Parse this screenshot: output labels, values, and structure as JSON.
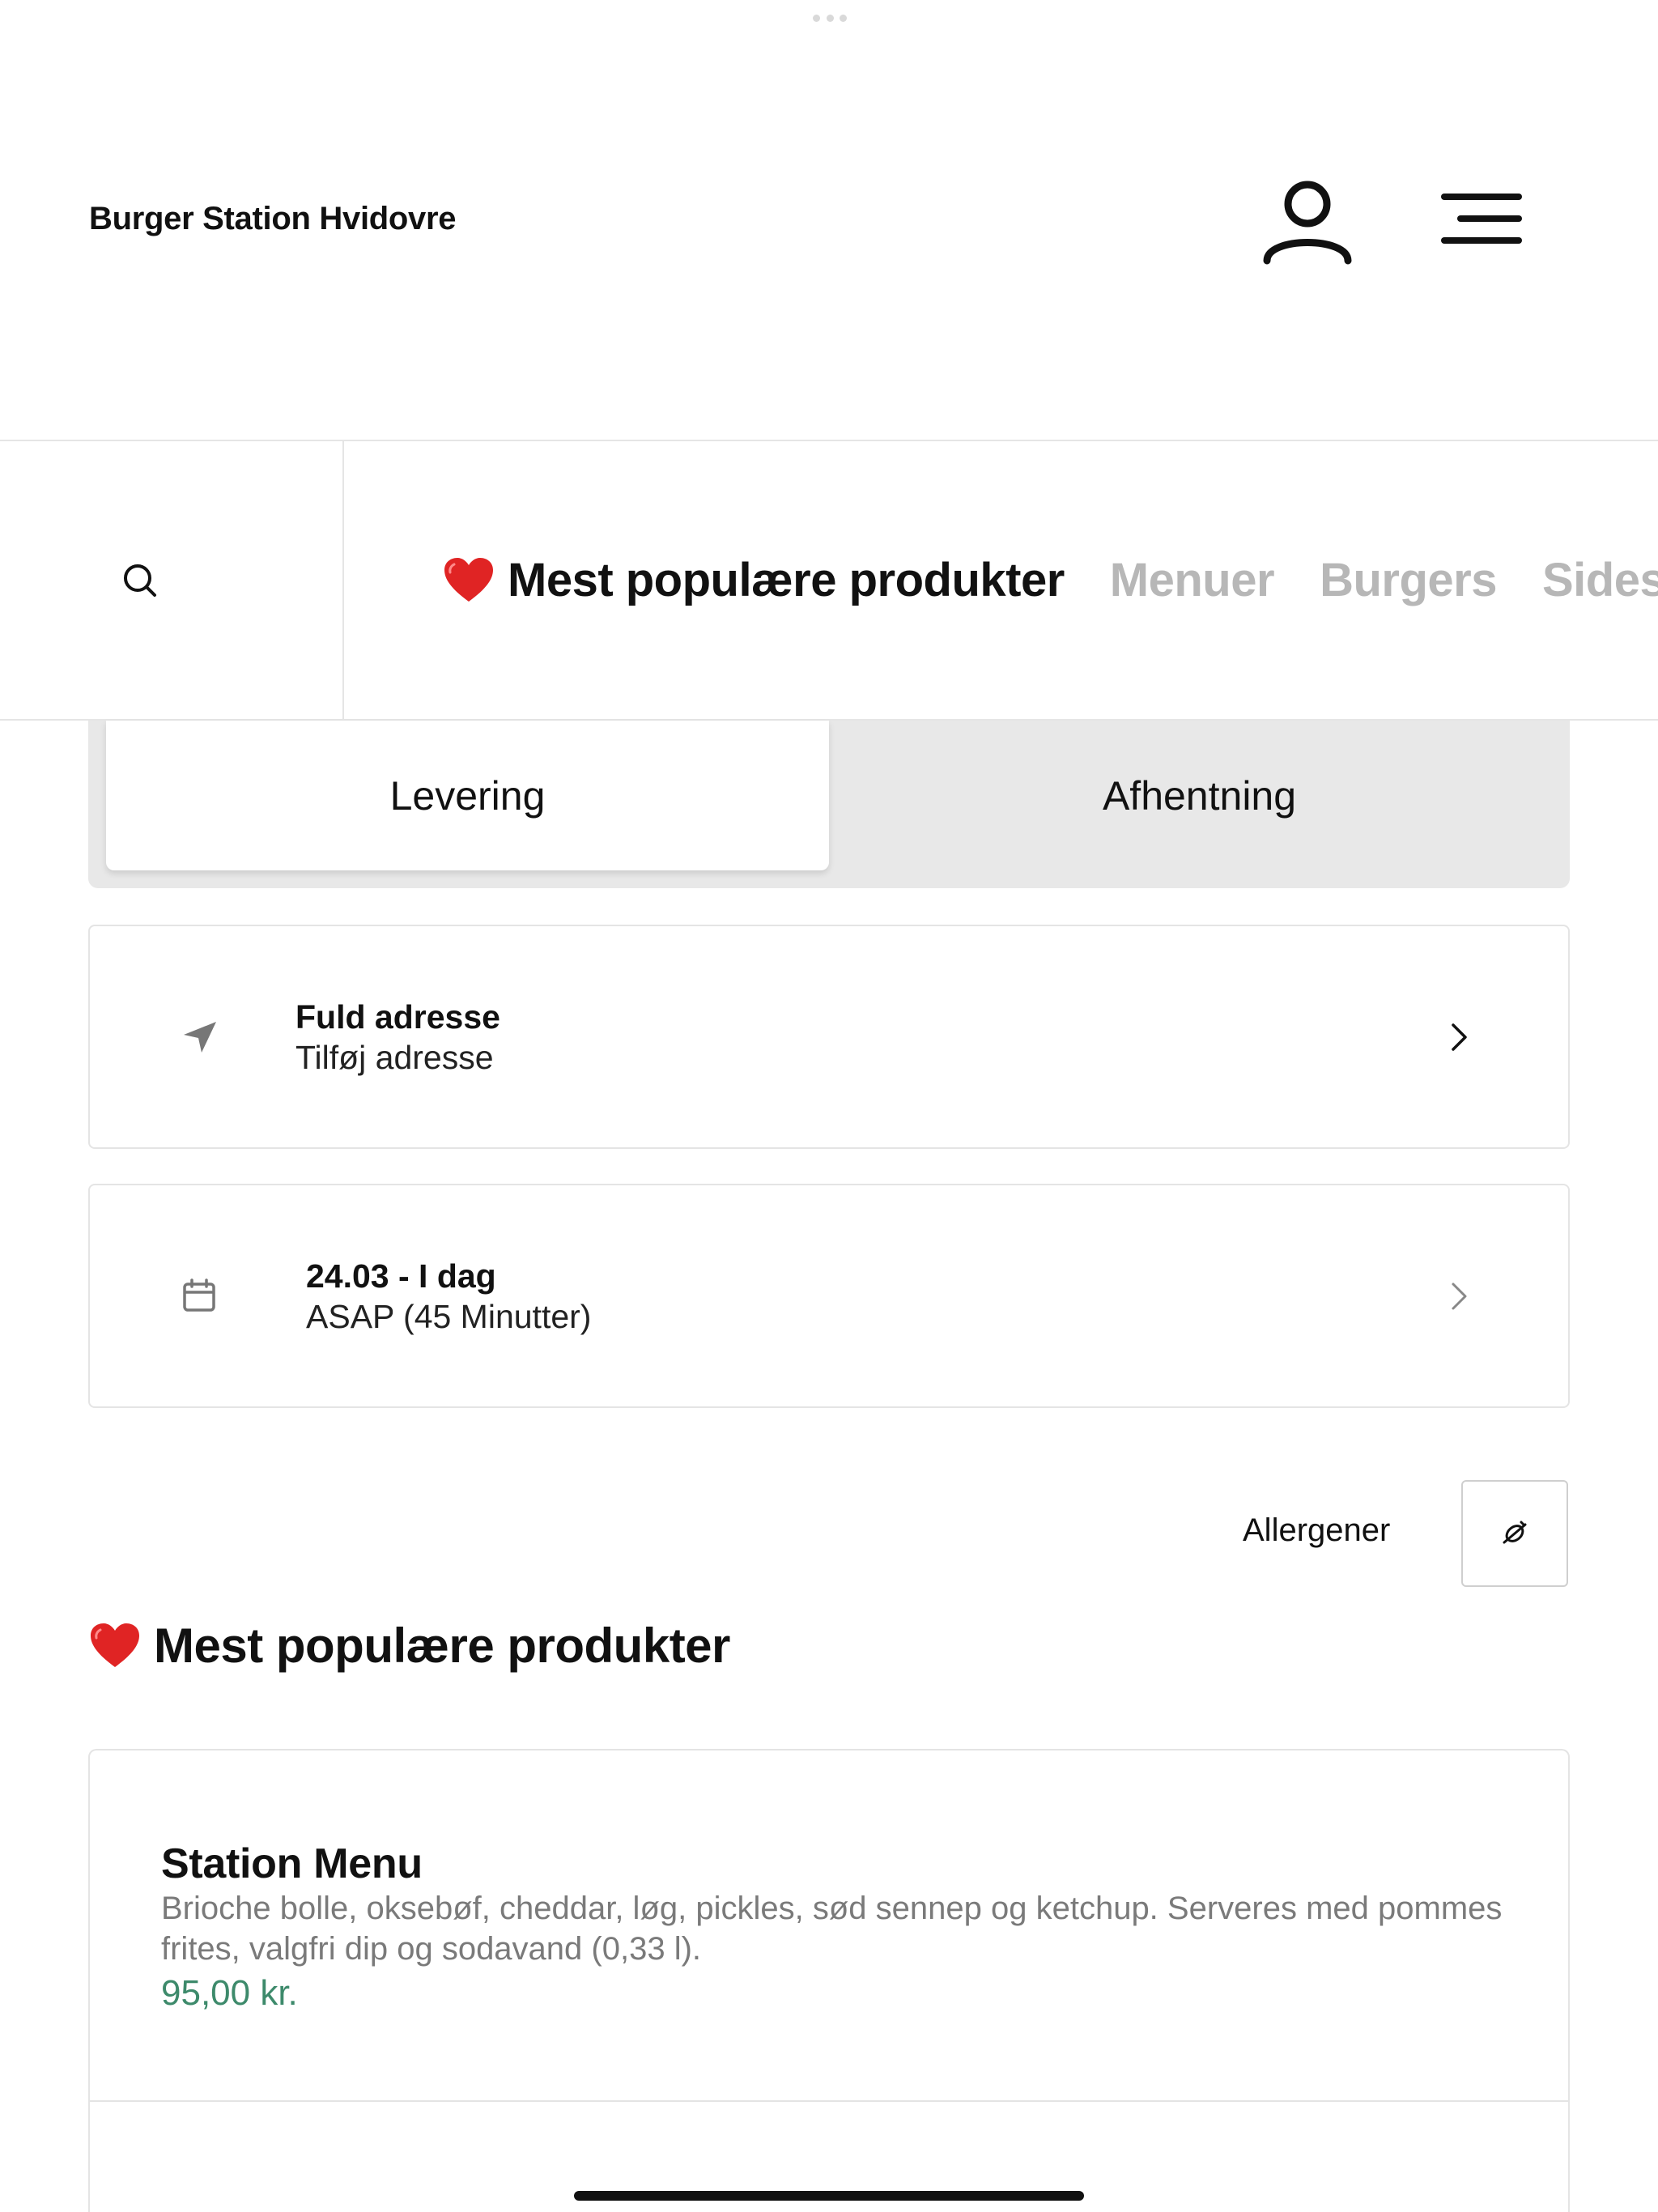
{
  "header": {
    "store_name": "Burger Station Hvidovre"
  },
  "category_nav": {
    "items": [
      {
        "label": "Mest populære produkter",
        "icon": "heart-icon",
        "active": true
      },
      {
        "label": "Menuer",
        "active": false
      },
      {
        "label": "Burgers",
        "active": false
      },
      {
        "label": "Sides",
        "active": false
      }
    ]
  },
  "order_type": {
    "delivery_label": "Levering",
    "pickup_label": "Afhentning",
    "selected": "Levering"
  },
  "address_card": {
    "title": "Fuld adresse",
    "subtitle": "Tilføj adresse",
    "icon": "location-arrow-icon"
  },
  "time_card": {
    "title": "24.03 - I dag",
    "subtitle": "ASAP (45 Minutter)",
    "icon": "calendar-icon"
  },
  "allergens": {
    "label": "Allergener",
    "icon": "allergen-filter-icon"
  },
  "section": {
    "title": "Mest populære produkter",
    "icon": "heart-icon"
  },
  "products": [
    {
      "name": "Station Menu",
      "description": "Brioche bolle, oksebøf, cheddar, løg, pickles, sød sennep og ketchup. Serveres med pommes frites, valgfri dip og sodavand (0,33 l).",
      "price": "95,00 kr."
    }
  ],
  "colors": {
    "accent_price": "#3d8a6b",
    "heart": "#e02424",
    "inactive_tab": "#b7b7b7"
  }
}
